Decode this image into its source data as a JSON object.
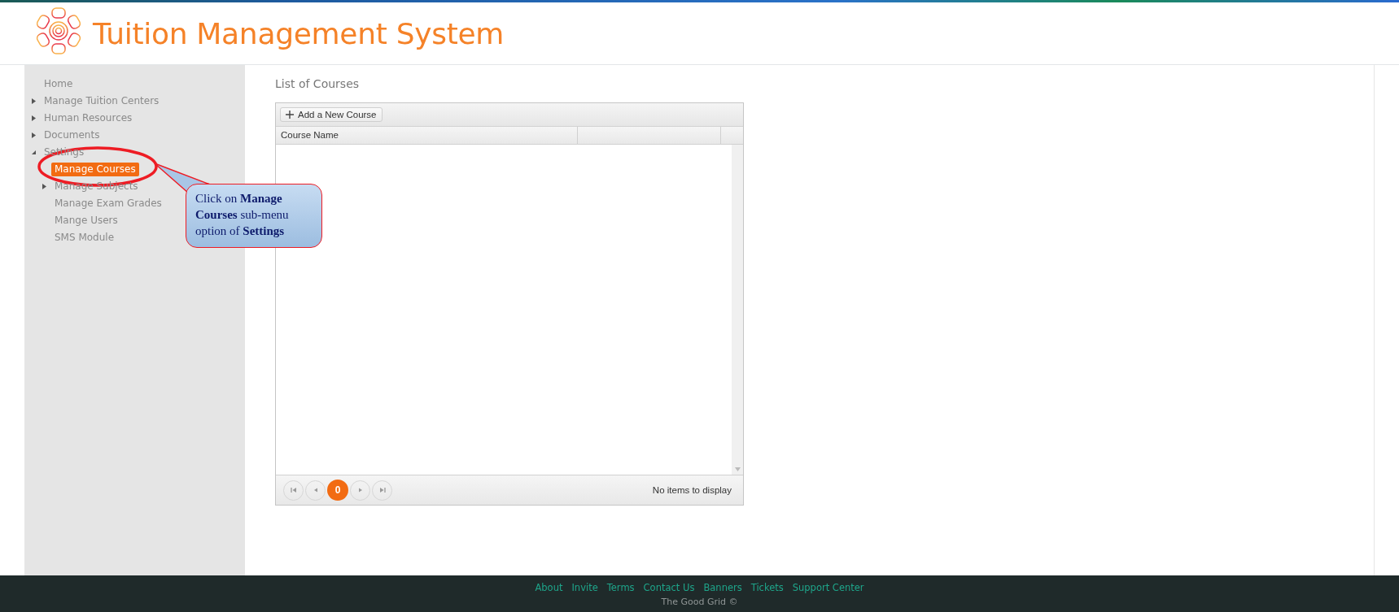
{
  "header": {
    "title": "Tuition Management System"
  },
  "sidebar": {
    "items": [
      {
        "label": "Home",
        "kind": "link",
        "selected": false
      },
      {
        "label": "Manage Tuition Centers",
        "kind": "group",
        "expanded": false,
        "selected": false
      },
      {
        "label": "Human Resources",
        "kind": "group",
        "expanded": false,
        "selected": false
      },
      {
        "label": "Documents",
        "kind": "group",
        "expanded": false,
        "selected": false
      },
      {
        "label": "Settings",
        "kind": "group",
        "expanded": true,
        "selected": false,
        "children": [
          {
            "label": "Manage Courses",
            "kind": "link",
            "selected": true
          },
          {
            "label": "Manage Subjects",
            "kind": "group",
            "expanded": false,
            "selected": false
          },
          {
            "label": "Manage Exam Grades",
            "kind": "link",
            "selected": false
          },
          {
            "label": "Mange Users",
            "kind": "link",
            "selected": false
          },
          {
            "label": "SMS Module",
            "kind": "link",
            "selected": false
          }
        ]
      }
    ]
  },
  "callout": {
    "text": "Click on **Manage Courses** sub-menu option of **Settings**"
  },
  "content": {
    "heading": "List of Courses",
    "grid": {
      "toolbar_button": "Add a New Course",
      "columns": [
        "Course Name"
      ],
      "pager": {
        "pages": [
          {
            "label": "0",
            "selected": true
          }
        ],
        "status": "No items to display"
      }
    }
  },
  "footer": {
    "links": [
      "About",
      "Invite",
      "Terms",
      "Contact Us",
      "Banners",
      "Tickets",
      "Support Center"
    ],
    "copyright": "The Good Grid ©"
  }
}
